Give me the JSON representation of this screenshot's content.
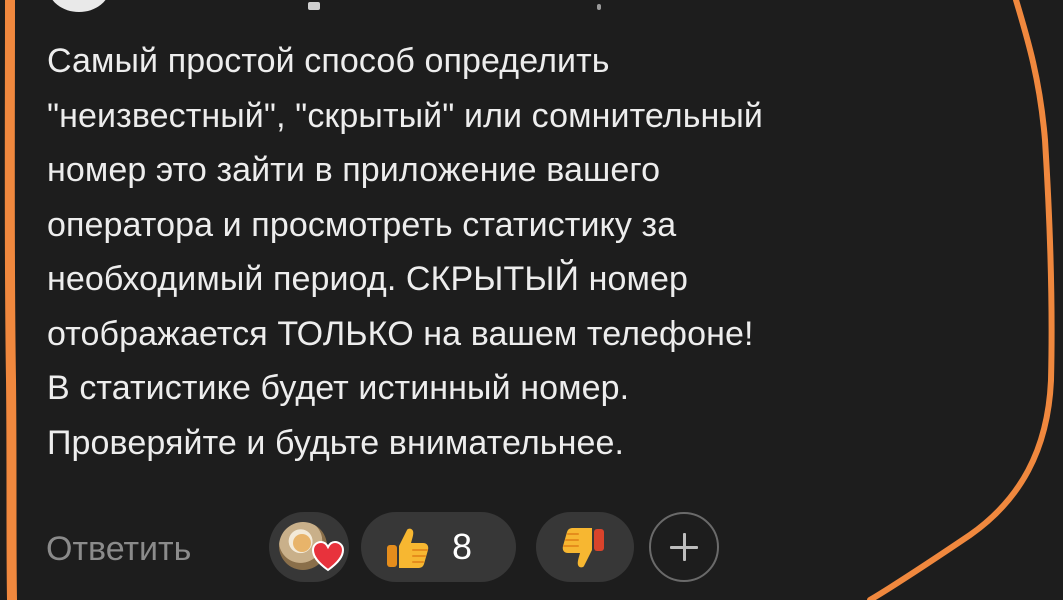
{
  "comment": {
    "text": "Самый простой способ определить\n\"неизвестный\", \"скрытый\" или сомнительный\nномер это зайти в приложение вашего\nоператора и просмотреть статистику за\nнеобходимый период. СКРЫТЫЙ номер\nотображается ТОЛЬКО на вашем телефоне!\nВ статистике будет истинный номер.\nПроверяйте и будьте внимательнее."
  },
  "actions": {
    "reply_label": "Ответить",
    "like_count": "8"
  },
  "icons": {
    "reactor_avatar": "user-avatar-icon",
    "reactor_heart": "heart-icon",
    "like": "thumbs-up-icon",
    "dislike": "thumbs-down-icon",
    "add": "plus-icon"
  },
  "colors": {
    "background": "#1d1d1d",
    "text": "#ededed",
    "muted_text": "#8b8b8b",
    "pill_background": "#373737",
    "highlight_stroke": "#f0883e",
    "heart": "#e8323c",
    "thumb": "#f7b731"
  }
}
